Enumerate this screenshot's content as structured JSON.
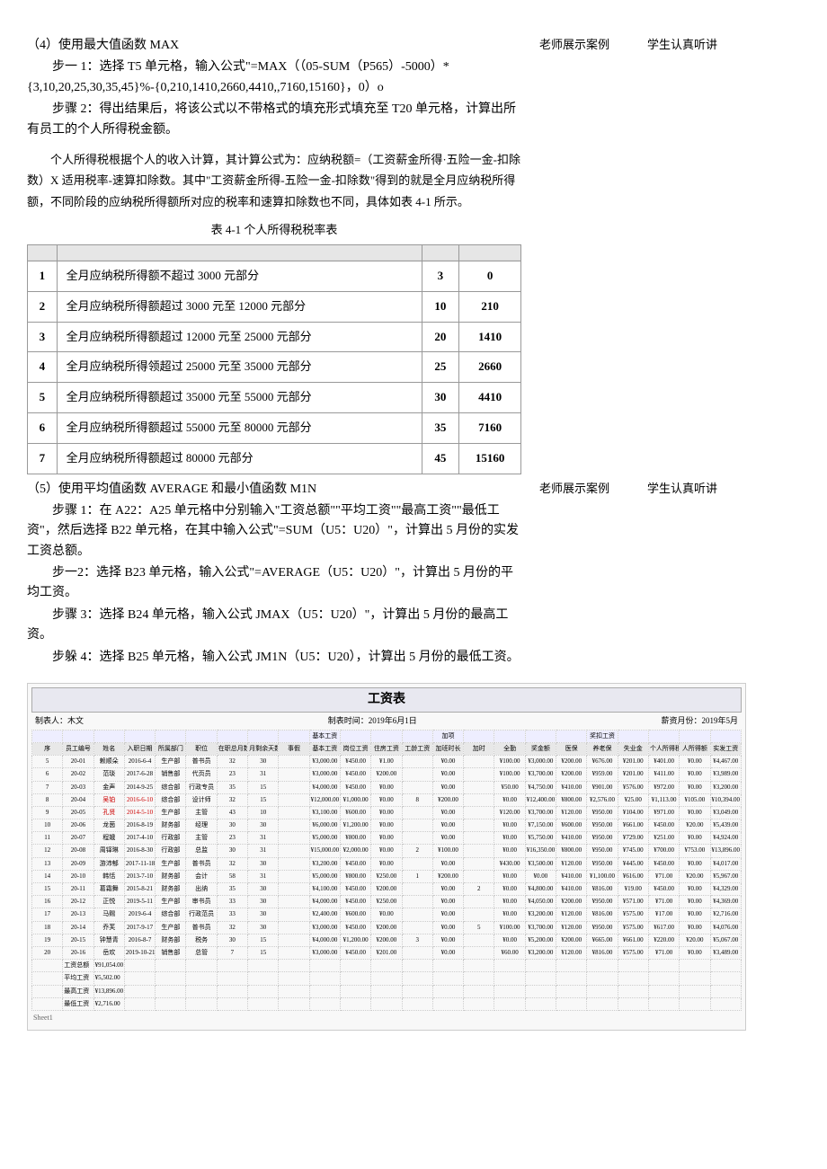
{
  "sections": {
    "s4": {
      "title": "（4）使用最大值函数 MAX",
      "step1": "步一 1：选择 T5 单元格，输入公式\"=MAX（（05-SUM（P565）-5000）*{3,10,20,25,30,35,45}%-{0,210,1410,2660,4410,,7160,15160}，0）o",
      "step2": "步骤 2：得出结果后，将该公式以不带格式的填充形式填充至 T20 单元格，计算出所有员工的个人所得税金额。"
    },
    "explain": "个人所得税根据个人的收入计算，其计算公式为：应纳税额=（工资薪金所得·五险一金-扣除数）X 适用税率-速算扣除数。其中\"工资薪金所得-五险一金-扣除数\"得到的就是全月应纳税所得额，不同阶段的应纳税所得额所对应的税率和速算扣除数也不同，具体如表 4-1 所示。",
    "table_caption": "表 4-1 个人所得税税率表",
    "tax_table": [
      {
        "no": "1",
        "desc": "全月应纳税所得额不超过 3000 元部分",
        "rate": "3",
        "deduct": "0"
      },
      {
        "no": "2",
        "desc": "全月应纳税所得额超过 3000 元至 12000 元部分",
        "rate": "10",
        "deduct": "210"
      },
      {
        "no": "3",
        "desc": "全月应纳税所得额超过 12000 元至 25000 元部分",
        "rate": "20",
        "deduct": "1410"
      },
      {
        "no": "4",
        "desc": "全月应纳税所得领超过 25000 元至 35000 元部分",
        "rate": "25",
        "deduct": "2660"
      },
      {
        "no": "5",
        "desc": "全月应纳税所得额超过 35000 元至 55000 元部分",
        "rate": "30",
        "deduct": "4410"
      },
      {
        "no": "6",
        "desc": "全月应纳税所得额超过 55000 元至 80000 元部分",
        "rate": "35",
        "deduct": "7160"
      },
      {
        "no": "7",
        "desc": "全月应纳税所得额超过 80000 元部分",
        "rate": "45",
        "deduct": "15160"
      }
    ],
    "s5": {
      "title": "（5）使用平均值函数 AVERAGE 和最小值函数 M1N",
      "step1": "步骤 1：在 A22：A25 单元格中分别输入\"工资总额\"\"平均工资\"\"最高工资\"\"最低工资\"，然后选择 B22 单元格，在其中输入公式\"=SUM（U5：U20）\"，计算出 5 月份的实发工资总额。",
      "step2": "步一2：选择 B23 单元格，输入公式\"=AVERAGE（U5：U20）\"，计算出 5 月份的平均工资。",
      "step3": "步骤 3：选择 B24 单元格，输入公式 JMAX（U5：U20）\"，计算出 5 月份的最高工资。",
      "step4": "步躲 4：选择 B25 单元格，输入公式 JM1N（U5：U20），计算出 5 月份的最低工资。"
    }
  },
  "sides": {
    "teacher_demo": "老师展示案例",
    "student_listen": "学生认真听讲"
  },
  "spreadsheet": {
    "title": "工资表",
    "maker_label": "制表人：木文",
    "made_time": "制表时间：2019年6月1日",
    "salary_month": "薪资月份：2019年5月",
    "group_headers": [
      "",
      "",
      "",
      "",
      "",
      "",
      "",
      "",
      "",
      "基本工资",
      "",
      "",
      "",
      "加项",
      "",
      "",
      "",
      "",
      "奖扣工资",
      "",
      "",
      "",
      ""
    ],
    "headers": [
      "序",
      "员工编号",
      "姓名",
      "入职日期",
      "所属部门",
      "职位",
      "在职总月数",
      "月剩余天数",
      "事假",
      "基本工资",
      "岗位工资",
      "住房工资",
      "工龄工资",
      "加班时长",
      "加时",
      "全勤",
      "奖金额",
      "医保",
      "养老保",
      "失业金",
      "个人所得税",
      "人所得额",
      "实发工资"
    ],
    "rows": [
      [
        "5",
        "20-01",
        "赖顺朵",
        "2016-6-4",
        "生产部",
        "普书员",
        "32",
        "30",
        "",
        "¥3,000.00",
        "¥450.00",
        "¥1.00",
        "",
        "¥0.00",
        "",
        "¥100.00",
        "¥3,000.00",
        "¥200.00",
        "¥676.00",
        "¥201.00",
        "¥401.00",
        "¥0.00",
        "¥4,467.00"
      ],
      [
        "6",
        "20-02",
        "范琰",
        "2017-6-28",
        "销售部",
        "代页员",
        "23",
        "31",
        "",
        "¥3,000.00",
        "¥450.00",
        "¥200.00",
        "",
        "¥0.00",
        "",
        "¥100.00",
        "¥3,700.00",
        "¥200.00",
        "¥959.00",
        "¥201.00",
        "¥411.00",
        "¥0.00",
        "¥3,989.00"
      ],
      [
        "7",
        "20-03",
        "金声",
        "2014-9-25",
        "综合部",
        "行政专员",
        "35",
        "15",
        "",
        "¥4,000.00",
        "¥450.00",
        "¥0.00",
        "",
        "¥0.00",
        "",
        "¥50.00",
        "¥4,750.00",
        "¥410.00",
        "¥901.00",
        "¥576.00",
        "¥972.00",
        "¥0.00",
        "¥3,200.00"
      ],
      [
        "8",
        "20-04",
        "吴铂",
        "2016-6-10",
        "综合部",
        "设计师",
        "32",
        "15",
        "",
        "¥12,000.00",
        "¥1,000.00",
        "¥0.00",
        "8",
        "¥200.00",
        "",
        "¥0.00",
        "¥12,400.00",
        "¥800.00",
        "¥2,576.00",
        "¥25.00",
        "¥1,113.00",
        "¥105.00",
        "¥10,394.00"
      ],
      [
        "9",
        "20-05",
        "孔贤",
        "2014-5-10",
        "生产部",
        "主管",
        "43",
        "10",
        "",
        "¥3,100.00",
        "¥600.00",
        "¥0.00",
        "",
        "¥0.00",
        "",
        "¥120.00",
        "¥3,700.00",
        "¥120.00",
        "¥950.00",
        "¥104.00",
        "¥971.00",
        "¥0.00",
        "¥3,049.00"
      ],
      [
        "10",
        "20-06",
        "龙茵",
        "2016-8-19",
        "财务部",
        "经理",
        "30",
        "30",
        "",
        "¥6,000.00",
        "¥1,200.00",
        "¥0.00",
        "",
        "¥0.00",
        "",
        "¥0.00",
        "¥7,150.00",
        "¥600.00",
        "¥950.00",
        "¥661.00",
        "¥450.00",
        "¥20.00",
        "¥5,439.00"
      ],
      [
        "11",
        "20-07",
        "程娥",
        "2017-4-10",
        "行政部",
        "主管",
        "23",
        "31",
        "",
        "¥5,000.00",
        "¥800.00",
        "¥0.00",
        "",
        "¥0.00",
        "",
        "¥0.00",
        "¥5,750.00",
        "¥410.00",
        "¥950.00",
        "¥729.00",
        "¥251.00",
        "¥0.00",
        "¥4,924.00"
      ],
      [
        "12",
        "20-08",
        "周铎琳",
        "2016-8-30",
        "行政部",
        "总监",
        "30",
        "31",
        "",
        "¥15,000.00",
        "¥2,000.00",
        "¥0.00",
        "2",
        "¥100.00",
        "",
        "¥0.00",
        "¥16,350.00",
        "¥800.00",
        "¥950.00",
        "¥745.00",
        "¥700.00",
        "¥753.00",
        "¥13,896.00"
      ],
      [
        "13",
        "20-09",
        "游沛郁",
        "2017-11-18",
        "生产部",
        "普书员",
        "32",
        "30",
        "",
        "¥3,200.00",
        "¥450.00",
        "¥0.00",
        "",
        "¥0.00",
        "",
        "¥430.00",
        "¥3,500.00",
        "¥120.00",
        "¥950.00",
        "¥445.00",
        "¥450.00",
        "¥0.00",
        "¥4,017.00"
      ],
      [
        "14",
        "20-10",
        "韩恬",
        "2013-7-10",
        "财务部",
        "会计",
        "58",
        "31",
        "",
        "¥5,000.00",
        "¥800.00",
        "¥250.00",
        "1",
        "¥200.00",
        "",
        "¥0.00",
        "¥0.00",
        "¥410.00",
        "¥1,100.00",
        "¥616.00",
        "¥71.00",
        "¥20.00",
        "¥5,967.00"
      ],
      [
        "15",
        "20-11",
        "葛霜舞",
        "2015-8-21",
        "财务部",
        "出纳",
        "35",
        "30",
        "",
        "¥4,100.00",
        "¥450.00",
        "¥200.00",
        "",
        "¥0.00",
        "2",
        "¥0.00",
        "¥4,800.00",
        "¥410.00",
        "¥816.00",
        "¥19.00",
        "¥450.00",
        "¥0.00",
        "¥4,329.00"
      ],
      [
        "16",
        "20-12",
        "正悦",
        "2019-5-11",
        "生产部",
        "审书员",
        "33",
        "30",
        "",
        "¥4,000.00",
        "¥450.00",
        "¥250.00",
        "",
        "¥0.00",
        "",
        "¥0.00",
        "¥4,050.00",
        "¥200.00",
        "¥950.00",
        "¥571.00",
        "¥71.00",
        "¥0.00",
        "¥4,369.00"
      ],
      [
        "17",
        "20-13",
        "马赐",
        "2019-6-4",
        "综合部",
        "行政范员",
        "33",
        "30",
        "",
        "¥2,400.00",
        "¥600.00",
        "¥0.00",
        "",
        "¥0.00",
        "",
        "¥0.00",
        "¥3,200.00",
        "¥120.00",
        "¥816.00",
        "¥575.00",
        "¥17.00",
        "¥0.00",
        "¥2,716.00"
      ],
      [
        "18",
        "20-14",
        "乔芙",
        "2017-9-17",
        "生产部",
        "普书员",
        "32",
        "30",
        "",
        "¥3,000.00",
        "¥450.00",
        "¥200.00",
        "",
        "¥0.00",
        "5",
        "¥100.00",
        "¥3,700.00",
        "¥120.00",
        "¥950.00",
        "¥575.00",
        "¥617.00",
        "¥0.00",
        "¥4,076.00"
      ],
      [
        "19",
        "20-15",
        "钟慧青",
        "2016-8-7",
        "财务部",
        "税务",
        "30",
        "15",
        "",
        "¥4,000.00",
        "¥1,200.00",
        "¥200.00",
        "3",
        "¥0.00",
        "",
        "¥0.00",
        "¥5,200.00",
        "¥200.00",
        "¥665.00",
        "¥661.00",
        "¥220.00",
        "¥20.00",
        "¥5,067.00"
      ],
      [
        "20",
        "20-16",
        "岳欢",
        "2019-10-21",
        "销售部",
        "总管",
        "7",
        "15",
        "",
        "¥3,000.00",
        "¥450.00",
        "¥201.00",
        "",
        "¥0.00",
        "",
        "¥60.00",
        "¥3,200.00",
        "¥120.00",
        "¥816.00",
        "¥575.00",
        "¥71.00",
        "¥0.00",
        "¥3,489.00"
      ]
    ],
    "summary": [
      {
        "label": "工资总额",
        "value": "¥91,054.00"
      },
      {
        "label": "平均工资",
        "value": "¥5,502.00"
      },
      {
        "label": "最高工资",
        "value": "¥13,896.00"
      },
      {
        "label": "最低工资",
        "value": "¥2,716.00"
      }
    ],
    "sheet_tab": "Sheet1"
  }
}
